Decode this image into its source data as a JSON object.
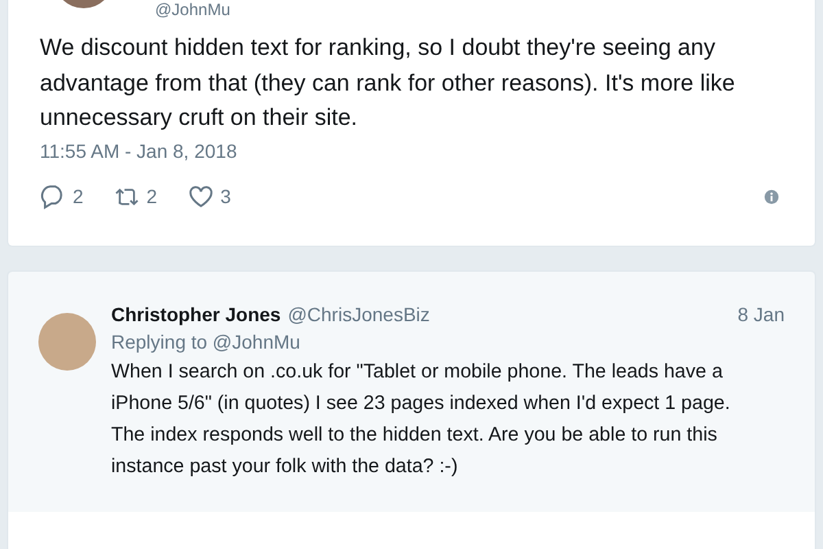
{
  "tweet": {
    "handle": "@JohnMu",
    "text": "We discount hidden text for ranking, so I doubt they're seeing any advantage from that (they can rank for other reasons). It's more like unnecessary cruft on their site.",
    "timestamp": "11:55 AM - Jan 8, 2018",
    "replies": "2",
    "retweets": "2",
    "likes": "3"
  },
  "reply": {
    "name": "Christopher Jones",
    "handle": "@ChrisJonesBiz",
    "date": "8 Jan",
    "replying_to": "Replying to @JohnMu",
    "text": "When I search on .co.uk for \"Tablet or mobile phone. The leads have a iPhone 5/6\" (in quotes) I see 23 pages indexed when I'd expect 1 page. The index responds well to the hidden text. Are you be able to run this instance past your folk with the data? :-)"
  }
}
